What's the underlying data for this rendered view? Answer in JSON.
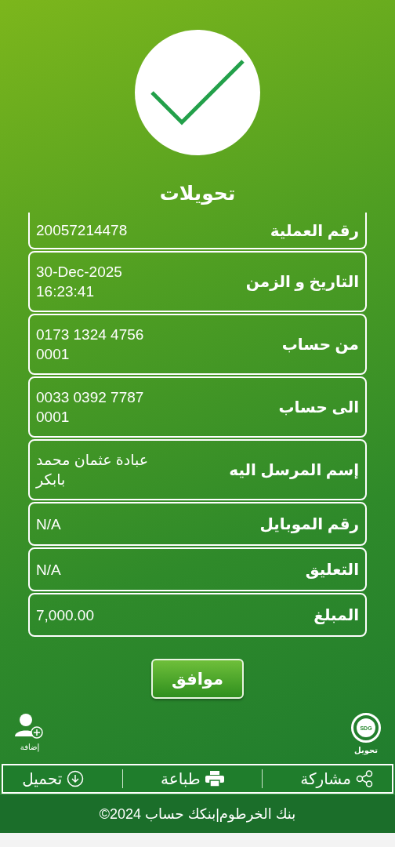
{
  "title": "تحويلات",
  "details": [
    {
      "label": "رقم العملية",
      "value": "20057214478"
    },
    {
      "label": "التاريخ و الزمن",
      "value": "30-Dec-2025\n16:23:41"
    },
    {
      "label": "من حساب",
      "value": "0173 1324 4756\n0001"
    },
    {
      "label": "الى حساب",
      "value": "0033 0392 7787\n0001"
    },
    {
      "label": "إسم المرسل اليه",
      "value": "عبادة عثمان محمد بابكر"
    },
    {
      "label": "رقم الموبايل",
      "value": "N/A"
    },
    {
      "label": "التعليق",
      "value": "N/A"
    },
    {
      "label": "المبلغ",
      "value": "7,000.00"
    }
  ],
  "confirm_button": "موافق",
  "shortcuts": [
    {
      "kind": "transfer",
      "label": "تحويل",
      "badge": "SDG"
    },
    {
      "kind": "add",
      "label": "إضافة"
    }
  ],
  "actions": [
    {
      "kind": "share",
      "label": "مشاركة"
    },
    {
      "kind": "print",
      "label": "طباعة"
    },
    {
      "kind": "download",
      "label": "تحميل"
    }
  ],
  "footer": "©2024 بنك الخرطوم|بنكك حساب"
}
